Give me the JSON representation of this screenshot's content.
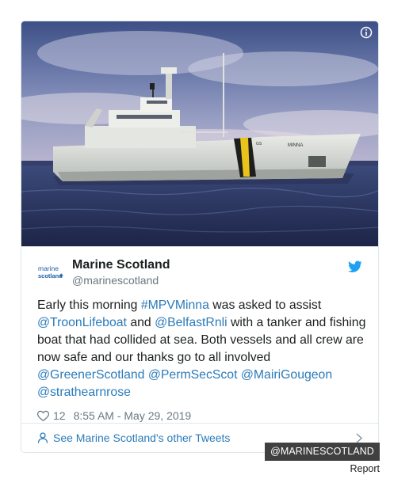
{
  "tweet": {
    "author_name": "Marine Scotland",
    "author_handle": "@marinescotland",
    "avatar_text_line1": "marine",
    "avatar_text_line2": "scotland",
    "text": [
      {
        "t": "Early this morning ",
        "link": false
      },
      {
        "t": "#MPVMinna",
        "link": true
      },
      {
        "t": " was asked to assist ",
        "link": false
      },
      {
        "t": "@TroonLifeboat",
        "link": true
      },
      {
        "t": " and ",
        "link": false
      },
      {
        "t": "@BelfastRnli",
        "link": true
      },
      {
        "t": " with a tanker and fishing boat that had collided at sea. Both vessels and all crew are now safe and our thanks go to all involved ",
        "link": false
      },
      {
        "t": "@GreenerScotland",
        "link": true
      },
      {
        "t": " ",
        "link": false
      },
      {
        "t": "@PermSecScot",
        "link": true
      },
      {
        "t": " ",
        "link": false
      },
      {
        "t": "@MairiGougeon",
        "link": true
      },
      {
        "t": " ",
        "link": false
      },
      {
        "t": "@strathearnrose",
        "link": true
      }
    ],
    "like_count": "12",
    "timestamp": "8:55 AM - May 29, 2019",
    "footer_link": "See Marine Scotland's other Tweets"
  },
  "image": {
    "ship_name": "MINNA",
    "ship_code": "GS"
  },
  "credit": "@MARINESCOTLAND",
  "report": "Report",
  "colors": {
    "link": "#2b7bb9",
    "text": "#1c2022",
    "muted": "#697882",
    "twitter_blue": "#1da1f2",
    "border": "#e1e8ed",
    "credit_bg": "#404040"
  },
  "icons": [
    "info-icon",
    "twitter-bird-icon",
    "heart-icon",
    "person-icon",
    "chevron-right-icon"
  ]
}
